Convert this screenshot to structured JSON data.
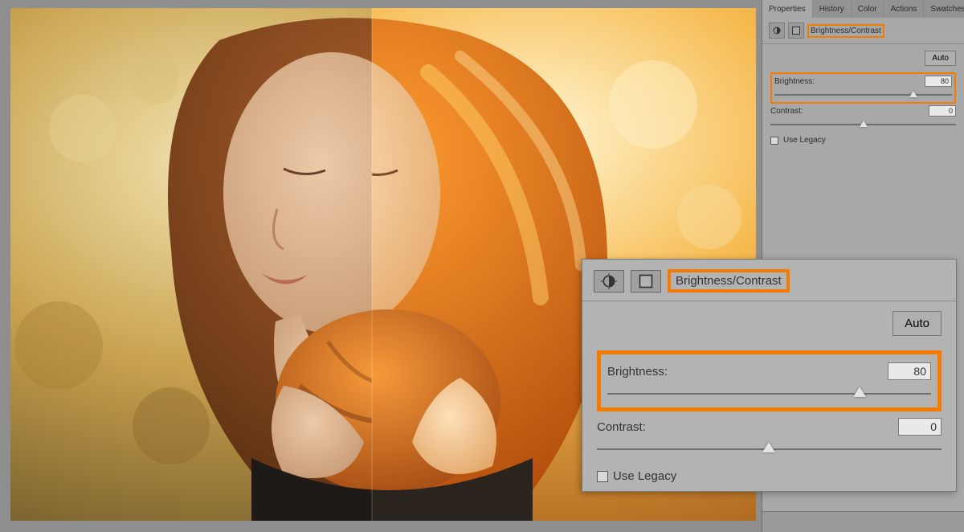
{
  "tabs": {
    "properties": "Properties",
    "history": "History",
    "color": "Color",
    "actions": "Actions",
    "swatches": "Swatches"
  },
  "panel": {
    "title": "Brightness/Contrast",
    "auto": "Auto",
    "brightness_label": "Brightness:",
    "brightness_value": "80",
    "contrast_label": "Contrast:",
    "contrast_value": "0",
    "legacy": "Use Legacy"
  },
  "highlight_color": "#f47a00"
}
